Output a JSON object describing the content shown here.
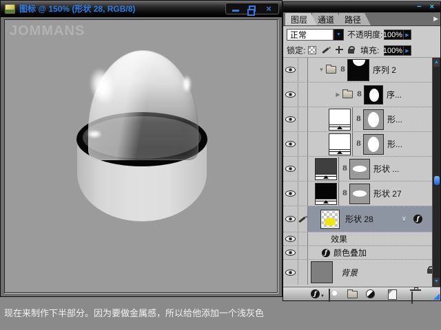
{
  "status_bar": {
    "text": "现在来制作下半部分。因为要做金属感，所以给他添加一个浅灰色"
  },
  "doc_window": {
    "title": "图标 @ 150% (形状 28, RGB/8)",
    "canvas_watermark": "JOMMANS"
  },
  "layers_panel": {
    "tabs": [
      {
        "label": "图层"
      },
      {
        "label": "通道"
      },
      {
        "label": "路径"
      }
    ],
    "blend_mode": {
      "value": "正常"
    },
    "opacity": {
      "label": "不透明度:",
      "value": "100%"
    },
    "lock": {
      "label": "锁定:"
    },
    "fill": {
      "label": "填充:",
      "value": "100%"
    },
    "layers": [
      {
        "name": "序列 2",
        "type": "group-expanded"
      },
      {
        "name": "序...",
        "type": "group-collapsed"
      },
      {
        "name": "形...",
        "type": "shape-fill-with-mask"
      },
      {
        "name": "形...",
        "type": "shape-fill-with-mask"
      },
      {
        "name": "形状 ...",
        "type": "shape-fill-with-mask"
      },
      {
        "name": "形状 27",
        "type": "shape-fill-with-mask"
      },
      {
        "name": "形状 28",
        "type": "shape-selected"
      },
      {
        "name": "效果",
        "type": "effects-header"
      },
      {
        "name": "颜色叠加",
        "type": "effect-item"
      },
      {
        "name": "背景",
        "type": "background-locked"
      }
    ]
  },
  "icons": {
    "close_glyph": "×",
    "panel_minimize": "−",
    "tri_down": "▼",
    "tri_right": "▶",
    "arrow_up": "▲",
    "arrow_down": "▼",
    "small_right_arrow": "▶",
    "panel_menu_arrow": "▶",
    "link_glyph": "8",
    "chevron_down": "∨",
    "fx_glyph": "ƒ"
  },
  "colors": {
    "accent_blue": "#2f7ce8",
    "titlebar_cyan": "#3cc9ef",
    "selected_row": "#8d95a3",
    "shape_yellow": "#f2e70d",
    "canvas_gray": "#9b9b9b"
  }
}
